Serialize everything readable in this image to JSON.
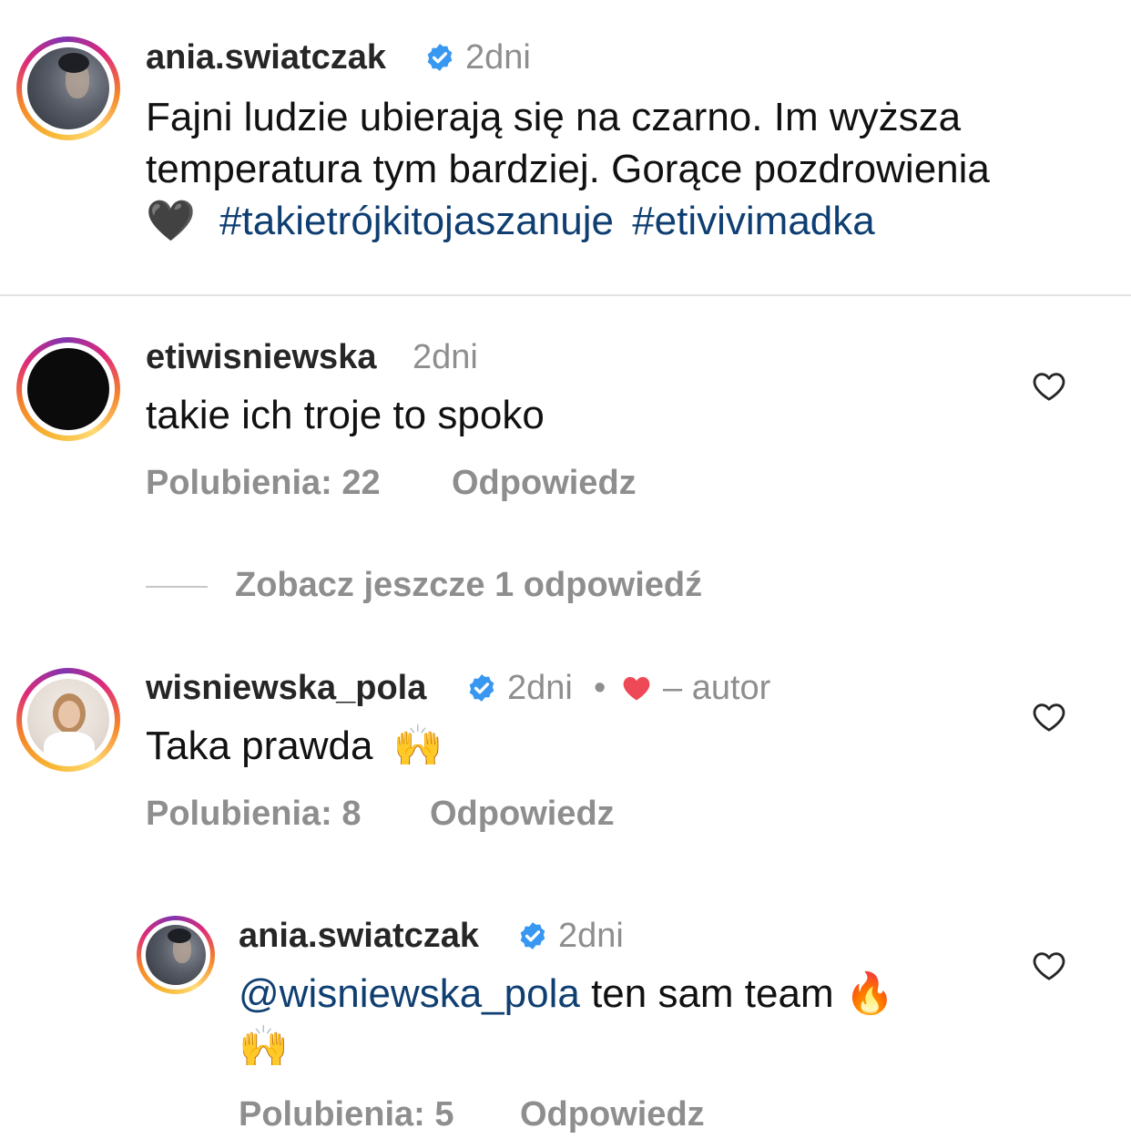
{
  "caption": {
    "username": "ania.swiatczak",
    "time": "2dni",
    "line1": "Fajni ludzie ubierają się na czarno. Im wyższa",
    "line2": "temperatura tym bardziej. Gorące pozdrowienia",
    "emoji": "🖤",
    "hashtag1": "#takietrójkitojaszanuje",
    "hashtag2": "#etivivimadka"
  },
  "comments": [
    {
      "username": "etiwisniewska",
      "time": "2dni",
      "text": "takie ich troje to spoko",
      "likes": "Polubienia: 22",
      "reply": "Odpowiedz"
    },
    {
      "username": "wisniewska_pola",
      "time": "2dni",
      "separator": "•",
      "author_heart": "❤",
      "author_label": "– autor",
      "text": "Taka prawda",
      "emoji": "🙌",
      "likes": "Polubienia: 8",
      "reply": "Odpowiedz"
    }
  ],
  "view_replies": "Zobacz jeszcze 1 odpowiedź",
  "reply": {
    "username": "ania.swiatczak",
    "time": "2dni",
    "mention": "@wisniewska_pola",
    "text": " ten sam team ",
    "emoji1": "🔥",
    "emoji2": "🙌",
    "likes": "Polubienia: 5",
    "reply": "Odpowiedz"
  },
  "colors": {
    "verified_badge": "#3897f0",
    "hashtag": "#0f3f72",
    "author_heart": "#ed4956",
    "muted_text": "#8e8e8e"
  },
  "icons": [
    "verified-badge-icon",
    "heart-outline-icon",
    "heart-filled-icon"
  ]
}
